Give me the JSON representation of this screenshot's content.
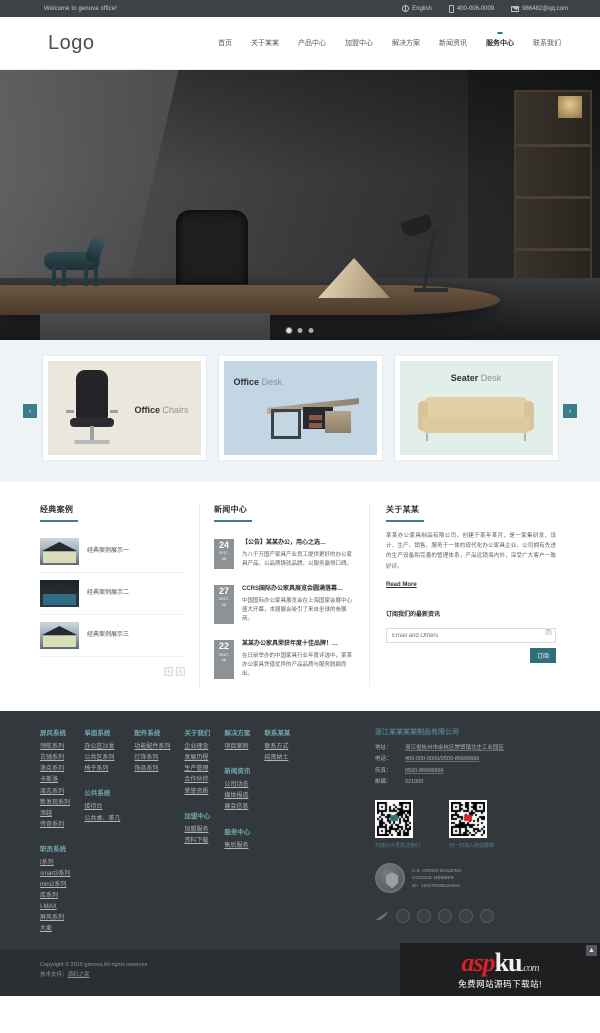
{
  "topbar": {
    "welcome": "Welcome to genova office!",
    "language": "English",
    "phone": "400-006-0009",
    "email": "986482@qq.com",
    "icons": {
      "globe": "globe-icon",
      "phone": "phone-icon",
      "mail": "mail-icon"
    }
  },
  "header": {
    "logo": "Logo",
    "nav": [
      {
        "label": "首页",
        "active": false
      },
      {
        "label": "关于某某",
        "active": false
      },
      {
        "label": "产品中心",
        "active": false
      },
      {
        "label": "加盟中心",
        "active": false
      },
      {
        "label": "解决方案",
        "active": false
      },
      {
        "label": "新闻资讯",
        "active": false
      },
      {
        "label": "服务中心",
        "active": true
      },
      {
        "label": "联系我们",
        "active": false
      }
    ]
  },
  "hero": {
    "slides_total": 3,
    "active_slide": 1
  },
  "products": {
    "prev_arrow": "‹",
    "next_arrow": "›",
    "cards": [
      {
        "bold": "Office",
        "light": "Chairs"
      },
      {
        "bold": "Office",
        "light": "Desk"
      },
      {
        "bold": "Seater",
        "light": "Desk"
      }
    ]
  },
  "cases": {
    "title": "经典案例",
    "items": [
      {
        "text": "经典案例展示一"
      },
      {
        "text": "经典案例展示二"
      },
      {
        "text": "经典案例展示三"
      }
    ],
    "pager": {
      "prev": "‹",
      "next": "›"
    }
  },
  "news": {
    "title": "新闻中心",
    "items": [
      {
        "day": "24",
        "year": "2017-",
        "month": "06",
        "title": "【公告】某某办公，用心之选…",
        "summary": "为八千万国产家具产业员工提供更好的办公家具产品，以品质铸就品牌，以服务赢得口碑。"
      },
      {
        "day": "27",
        "year": "2017-",
        "month": "06",
        "title": "CCRS国际办公家具展览会圆满落幕…",
        "summary": "中国国际办公家具展览会在上海国家会展中心盛大开幕，本届展会吸引了来自全球的参展商。"
      },
      {
        "day": "22",
        "year": "2017-",
        "month": "06",
        "title": "某某办公家具荣获年度十佳品牌！…",
        "summary": "在日前举办的中国家具行业年度评选中，某某办公家具凭借优异的产品品质与服务脱颖而出。"
      }
    ]
  },
  "about": {
    "title": "关于某某",
    "body": "某某办公家具制品有限公司，创建于某年某月，是一家集研发、设计、生产、销售、服务于一体的现代化办公家具企业。公司拥有先进的生产设备和完善的管理体系，产品远销海内外，深受广大客户一致好评。",
    "read_more": "Read More",
    "subscribe_title": "订阅我们的最新资讯",
    "subscribe_placeholder": "Email and Others",
    "subscribe_clear": "×",
    "subscribe_button": "订阅"
  },
  "footer": {
    "columns": [
      {
        "groups": [
          {
            "head": "屏风系统",
            "links": [
              "领航系列",
              "古驰系列",
              "洛克系列",
              "卡斯洛",
              "凌志系列",
              "新发现系列",
              "添越",
              "传奇系列"
            ]
          },
          {
            "head": "职员系统",
            "links": [
              "I系列",
              "smart3系列",
              "mini2系列",
              "库系列",
              "I-MAX",
              "屏风系列",
              "大麦"
            ]
          }
        ]
      },
      {
        "groups": [
          {
            "head": "单面系统",
            "links": [
              "办公区沙发",
              "公共区系列",
              "椅子系列"
            ]
          },
          {
            "head": "公共系统",
            "links": [
              "接待台",
              "公共桌、茶几"
            ]
          }
        ]
      },
      {
        "groups": [
          {
            "head": "配件系统",
            "links": [
              "功能配件系列",
              "灯饰系列",
              "饰品系列"
            ]
          }
        ]
      },
      {
        "groups": [
          {
            "head": "关于我们",
            "links": [
              "企业理念",
              "发展历程",
              "生产管理",
              "合作伙伴",
              "荣誉资质"
            ]
          },
          {
            "head": "加盟中心",
            "links": [
              "加盟服务",
              "资料下载"
            ]
          }
        ]
      },
      {
        "groups": [
          {
            "head": "解决方案",
            "links": [
              "项目案例"
            ]
          },
          {
            "head": "新闻资讯",
            "links": [
              "公司动态",
              "媒体报道",
              "展会信息"
            ]
          },
          {
            "head": "服务中心",
            "links": [
              "售后服务"
            ]
          }
        ]
      },
      {
        "groups": [
          {
            "head": "联系某某",
            "links": [
              "联系方式",
              "招贤纳士"
            ]
          }
        ]
      }
    ],
    "contact": {
      "company": "浙江某某某某制品有限公司",
      "rows": [
        {
          "key": "地址：",
          "value": "浙江省杭州市余杭区崇贤镇北庄工业园区"
        },
        {
          "key": "电话：",
          "value": "400-000-0000/0500-86666666"
        },
        {
          "key": "传真：",
          "value": "0500-86666666"
        },
        {
          "key": "邮编：",
          "value": "221000"
        }
      ],
      "qr": [
        {
          "caption": "扫描公众号关注我们"
        },
        {
          "caption": "扫一扫加入微信群聊"
        }
      ],
      "badge": {
        "line1": "U.S. GREEN BUILDING",
        "line2": "COUNCIL MEMBER",
        "line3": "ID：104479185423463"
      }
    }
  },
  "copyright": {
    "line1": "Copyright © 2015 genova All rights reserves",
    "line2_prefix": "技术支持：",
    "line2_link": "源码之家"
  },
  "watermark": {
    "part1": "asp",
    "part2": "ku",
    "part3": ".com",
    "tagline": "免费网站源码下载站!",
    "back_to_top": "▲"
  },
  "colors": {
    "accent": "#3b7e89",
    "topbar_bg": "#3d4246",
    "footer_bg": "#33383c",
    "copy_bg": "#2b2f33",
    "heading_teal": "#6fa7ad"
  }
}
